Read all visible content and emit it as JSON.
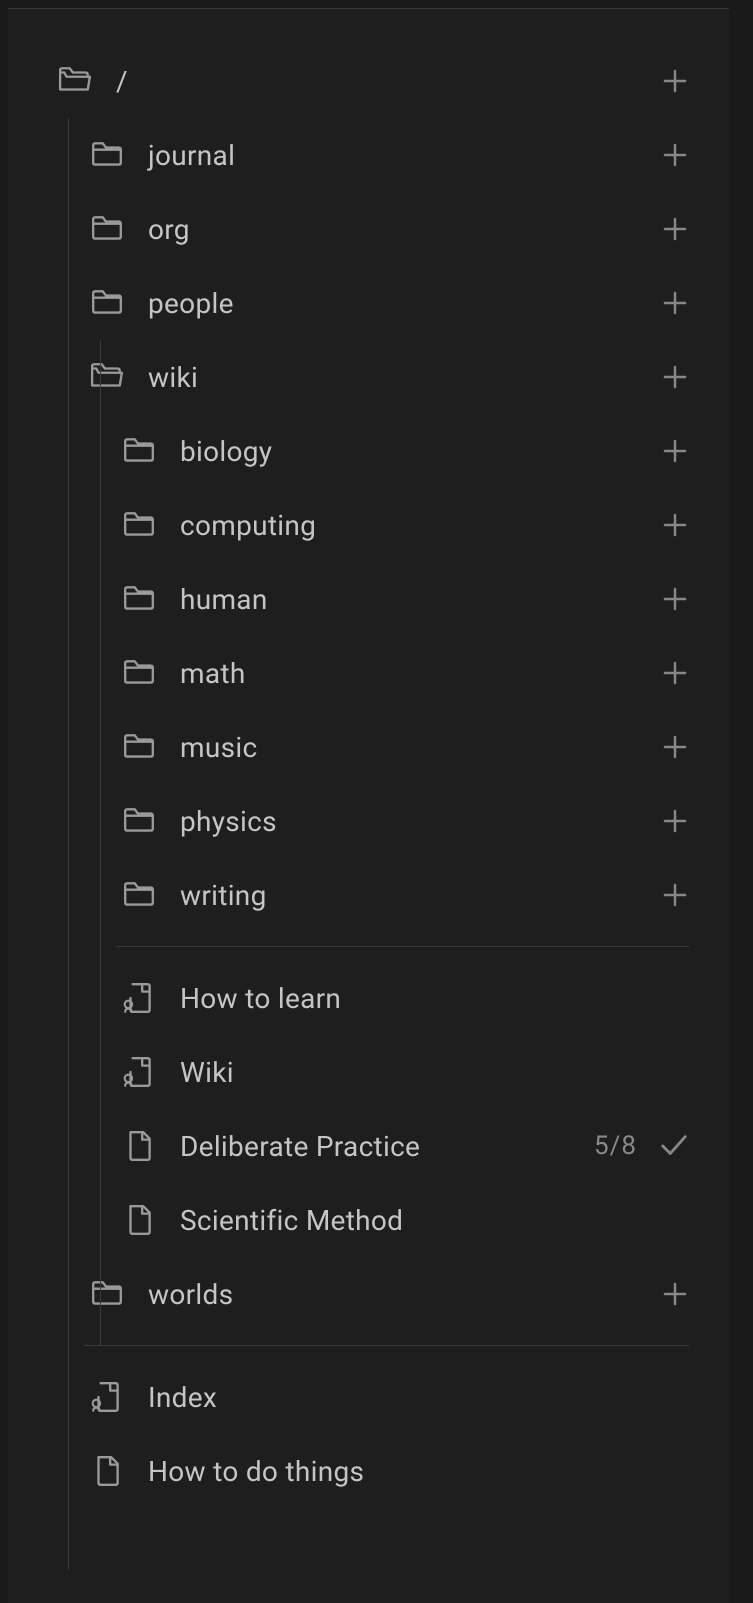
{
  "root": {
    "label": "/"
  },
  "level1": {
    "journal": "journal",
    "org": "org",
    "people": "people",
    "wiki": "wiki",
    "worlds": "worlds"
  },
  "wiki_children": {
    "biology": "biology",
    "computing": "computing",
    "human": "human",
    "math": "math",
    "music": "music",
    "physics": "physics",
    "writing": "writing"
  },
  "wiki_notes": {
    "how_to_learn": "How to learn",
    "wiki": "Wiki",
    "deliberate_practice": "Deliberate Practice",
    "deliberate_practice_count": "5/8",
    "scientific_method": "Scientific Method"
  },
  "root_notes": {
    "index": "Index",
    "how_to_do_things": "How to do things"
  }
}
